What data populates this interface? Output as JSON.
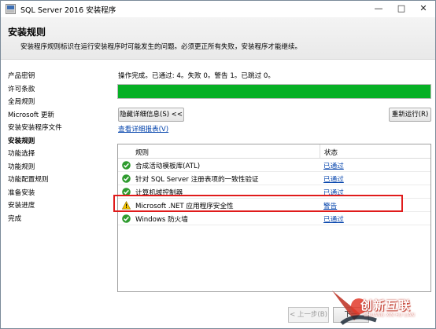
{
  "window": {
    "title": "SQL Server 2016 安装程序"
  },
  "header": {
    "title": "安装规则",
    "description": "安装程序规则标识在运行安装程序时可能发生的问题。必须更正所有失败，安装程序才能继续。"
  },
  "sidebar": {
    "items": [
      {
        "label": "产品密钥"
      },
      {
        "label": "许可条款"
      },
      {
        "label": "全局规则"
      },
      {
        "label": "Microsoft 更新"
      },
      {
        "label": "安装安装程序文件"
      },
      {
        "label": "安装规则",
        "active": true
      },
      {
        "label": "功能选择"
      },
      {
        "label": "功能规则"
      },
      {
        "label": "功能配置规则"
      },
      {
        "label": "准备安装"
      },
      {
        "label": "安装进度"
      },
      {
        "label": "完成"
      }
    ]
  },
  "main": {
    "status_text": "操作完成。已通过: 4。失败 0。警告 1。已跳过 0。",
    "progress": 1.0,
    "hide_details_label": "隐藏详细信息(S) <<",
    "rerun_label": "重新运行(R)",
    "view_report_label": "查看详细报表(V)",
    "table": {
      "headers": {
        "rule": "规则",
        "status": "状态"
      },
      "rows": [
        {
          "icon": "check-icon",
          "rule": "合成活动模板库(ATL)",
          "status": "已通过"
        },
        {
          "icon": "check-icon",
          "rule": "针对 SQL Server 注册表项的一致性验证",
          "status": "已通过"
        },
        {
          "icon": "check-icon",
          "rule": "计算机域控制器",
          "status": "已通过"
        },
        {
          "icon": "warning-icon",
          "rule": "Microsoft .NET 应用程序安全性",
          "status": "警告"
        },
        {
          "icon": "check-icon",
          "rule": "Windows 防火墙",
          "status": "已通过"
        }
      ]
    }
  },
  "footer": {
    "back_label": "< 上一步(B)",
    "next_label": "下一"
  },
  "watermark": {
    "text": "创新互联",
    "sub": "CHUANG XIN HU LIAN"
  },
  "colors": {
    "progress": "#06b025",
    "link": "#0645ad",
    "highlight": "#e01b1b",
    "pass": "#2e9b2e",
    "warn": "#f2c200"
  }
}
